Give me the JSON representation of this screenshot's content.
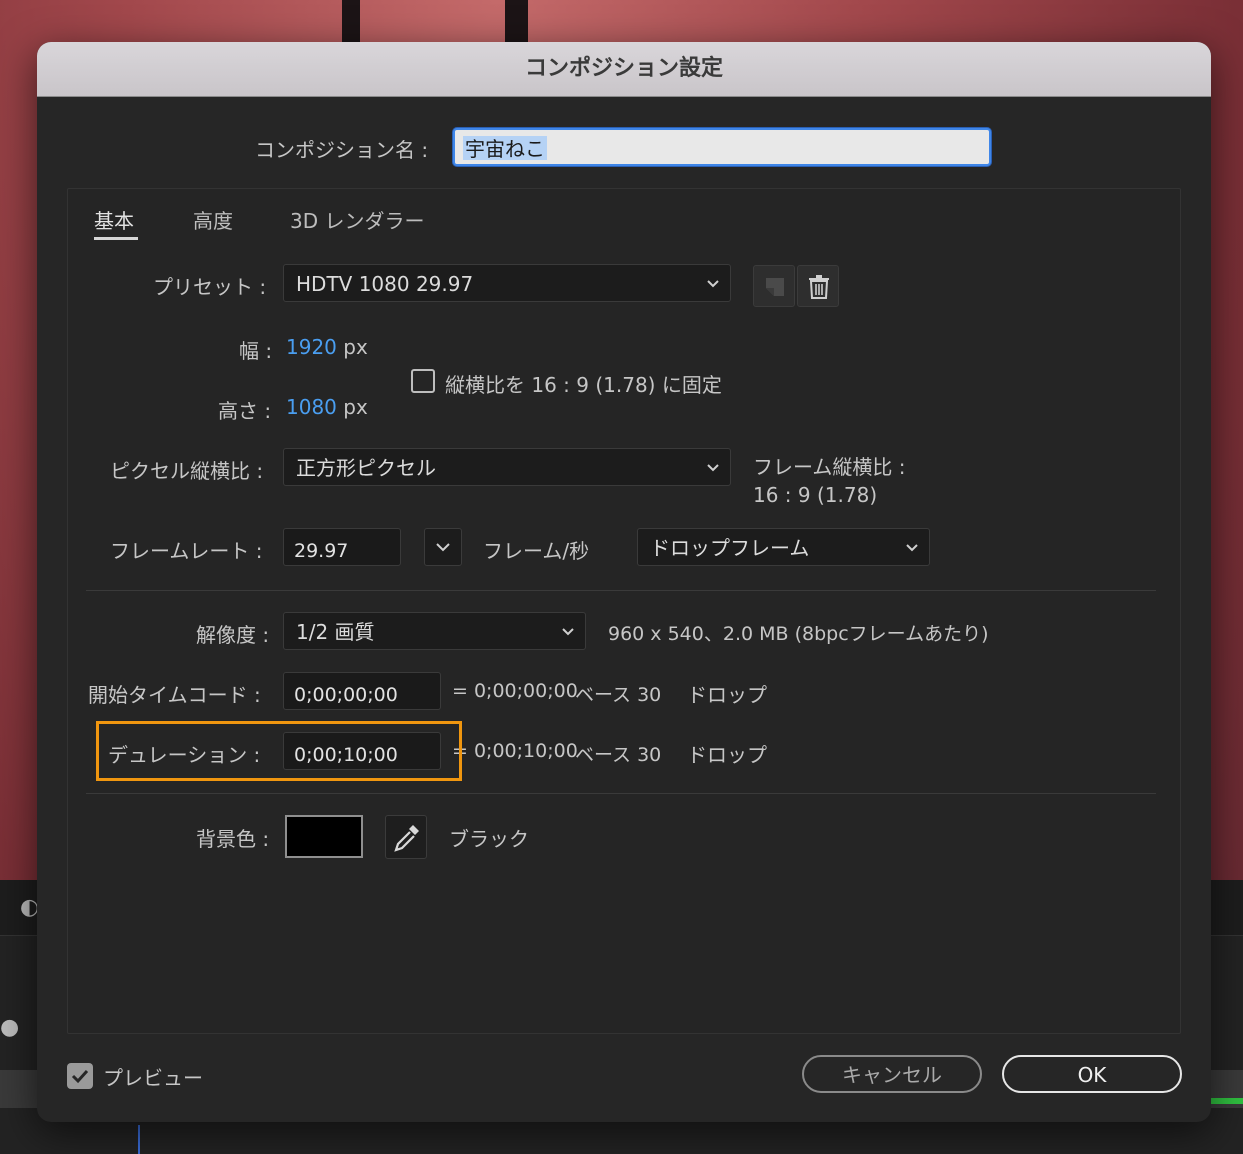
{
  "dialog": {
    "title": "コンポジション設定",
    "comp_name_label": "コンポジション名 :",
    "comp_name_value": "宇宙ねこ"
  },
  "tabs": [
    {
      "label": "基本",
      "active": true
    },
    {
      "label": "高度",
      "active": false
    },
    {
      "label": "3D レンダラー",
      "active": false
    }
  ],
  "preset": {
    "label": "プリセット :",
    "value": "HDTV 1080 29.97"
  },
  "width": {
    "label": "幅 :",
    "value": "1920",
    "unit": "px"
  },
  "height": {
    "label": "高さ :",
    "value": "1080",
    "unit": "px"
  },
  "aspect_lock": {
    "label": "縦横比を 16 : 9 (1.78) に固定",
    "checked": false
  },
  "pixel_aspect": {
    "label": "ピクセル縦横比 :",
    "value": "正方形ピクセル"
  },
  "frame_aspect": {
    "label": "フレーム縦横比 :",
    "value": "16 : 9 (1.78)"
  },
  "frame_rate": {
    "label": "フレームレート :",
    "value": "29.97",
    "unit": "フレーム/秒",
    "drop_mode": "ドロップフレーム"
  },
  "resolution": {
    "label": "解像度 :",
    "value": "1/2 画質",
    "info": "960 x 540、2.0 MB (8bpcフレームあたり)"
  },
  "start_timecode": {
    "label": "開始タイムコード :",
    "value": "0;00;00;00",
    "equals": "= 0;00;00;00",
    "base": "ベース 30",
    "drop": "ドロップ"
  },
  "duration": {
    "label": "デュレーション :",
    "value": "0;00;10;00",
    "equals": "= 0;00;10;00",
    "base": "ベース 30",
    "drop": "ドロップ"
  },
  "background": {
    "label": "背景色 :",
    "color": "#000000",
    "color_name": "ブラック"
  },
  "footer": {
    "preview_label": "プレビュー",
    "preview_checked": true,
    "cancel_label": "キャンセル",
    "ok_label": "OK"
  },
  "colors": {
    "accent_blue": "#4a9ef0",
    "highlight_orange": "#f0960f",
    "dialog_bg": "#262626"
  }
}
